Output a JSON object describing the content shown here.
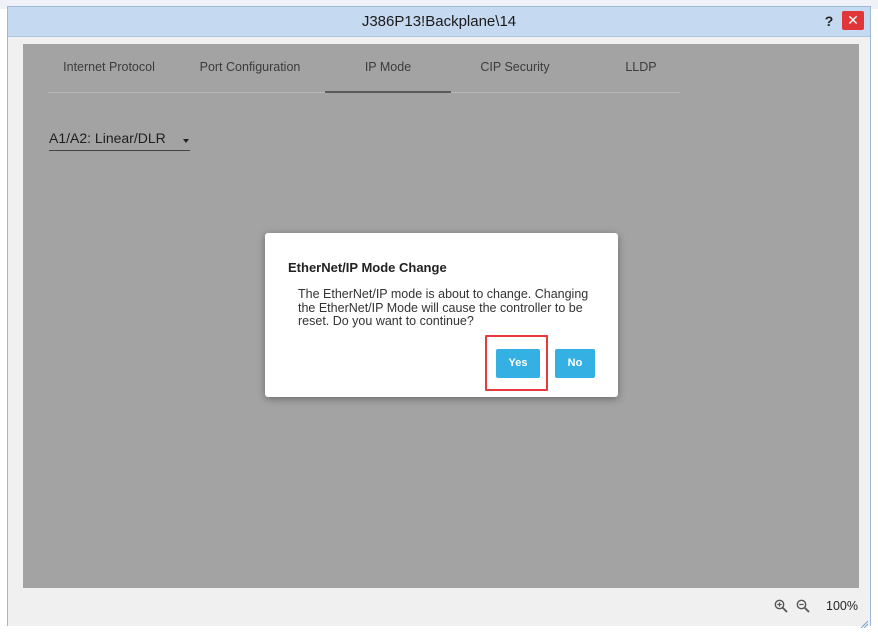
{
  "window": {
    "title": "J386P13!Backplane\\14",
    "help_label": "?",
    "close_label": "✕"
  },
  "tabs": [
    {
      "label": "Internet Protocol",
      "active": false
    },
    {
      "label": "Port Configuration",
      "active": false
    },
    {
      "label": "IP Mode",
      "active": true
    },
    {
      "label": "CIP Security",
      "active": false
    },
    {
      "label": "LLDP",
      "active": false
    }
  ],
  "mode_select": {
    "value": "A1/A2: Linear/DLR",
    "icon": "chevron-down-icon"
  },
  "dialog": {
    "title": "EtherNet/IP Mode Change",
    "message": "The EtherNet/IP mode is about to change. Changing the EtherNet/IP Mode will cause the controller to be reset. Do you want to continue?",
    "yes_label": "Yes",
    "no_label": "No",
    "highlight_color": "#e8393c",
    "button_color": "#35b0e3"
  },
  "statusbar": {
    "zoom_in_icon": "zoom-in-icon",
    "zoom_out_icon": "zoom-out-icon",
    "zoom_level": "100%"
  }
}
